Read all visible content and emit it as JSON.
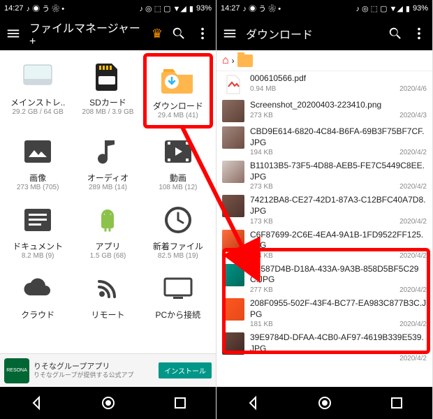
{
  "status": {
    "time": "14:27",
    "battery": "93%"
  },
  "left": {
    "title": "ファイルマネージャー +",
    "cells": [
      {
        "label": "メインストレ..",
        "sub": "29.2 GB / 64 GB"
      },
      {
        "label": "SDカード",
        "sub": "208 MB / 3.9 GB"
      },
      {
        "label": "ダウンロード",
        "sub": "29.4 MB (41)"
      },
      {
        "label": "画像",
        "sub": "273 MB (705)"
      },
      {
        "label": "オーディオ",
        "sub": "289 MB (14)"
      },
      {
        "label": "動画",
        "sub": "108 MB (12)"
      },
      {
        "label": "ドキュメント",
        "sub": "8.2 MB (9)"
      },
      {
        "label": "アプリ",
        "sub": "1.5 GB (68)"
      },
      {
        "label": "新着ファイル",
        "sub": "82.5 MB (19)"
      },
      {
        "label": "クラウド",
        "sub": ""
      },
      {
        "label": "リモート",
        "sub": ""
      },
      {
        "label": "PCから接続",
        "sub": ""
      }
    ],
    "ad": {
      "title": "りそなグループアプリ",
      "sub": "りそなグループが提供する公式アプ",
      "btn": "インストール"
    }
  },
  "right": {
    "title": "ダウンロード",
    "files": [
      {
        "name": "000610566.pdf",
        "size": "0.94 MB",
        "date": "2020/4/6"
      },
      {
        "name": "Screenshot_20200403-223410.png",
        "size": "273 KB",
        "date": "2020/4/3"
      },
      {
        "name": "CBD9E614-6820-4C84-B6FA-69B3F75BF7CF.JPG",
        "size": "194 KB",
        "date": "2020/4/2"
      },
      {
        "name": "B11013B5-73F5-4D88-AEB5-FE7C5449C8EE.JPG",
        "size": "273 KB",
        "date": "2020/4/2"
      },
      {
        "name": "74212BA8-CE27-42D1-87A3-C12BFC40A7D8.JPG",
        "size": "173 KB",
        "date": "2020/4/2"
      },
      {
        "name": "C6F87699-2C6E-4EA4-9A1B-1FD9522FF125.JPG",
        "size": "244 KB",
        "date": "2020/4/2"
      },
      {
        "name": "9C587D4B-D18A-433A-9A3B-858D5BF5C29C.JPG",
        "size": "277 KB",
        "date": "2020/4/2"
      },
      {
        "name": "208F0955-502F-43F4-BC77-EA983C877B3C.JPG",
        "size": "181 KB",
        "date": "2020/4/2"
      },
      {
        "name": "39E9784D-DFAA-4CB0-AF97-4619B339E539.JPG",
        "size": "",
        "date": "2020/4/2"
      }
    ]
  }
}
